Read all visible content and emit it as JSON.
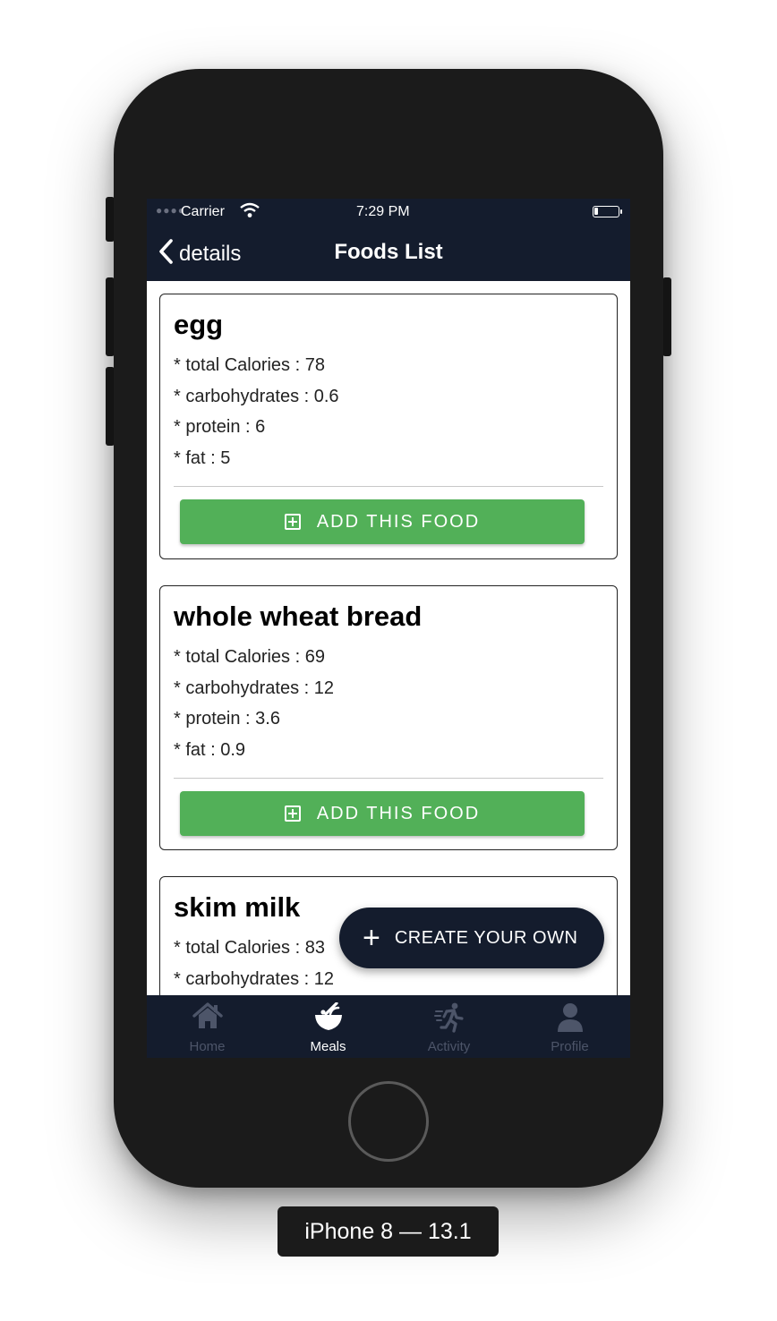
{
  "status_bar": {
    "carrier": "Carrier",
    "time": "7:29 PM"
  },
  "nav": {
    "back_label": "details",
    "title": "Foods List"
  },
  "foods": [
    {
      "name": "egg",
      "calories": "* total Calories : 78",
      "carbs": "* carbohydrates : 0.6",
      "protein": "* protein : 6",
      "fat": "* fat : 5"
    },
    {
      "name": "whole wheat bread",
      "calories": "* total Calories : 69",
      "carbs": "* carbohydrates : 12",
      "protein": "* protein : 3.6",
      "fat": "* fat : 0.9"
    },
    {
      "name": "skim milk",
      "calories": "* total Calories : 83",
      "carbs": "* carbohydrates : 12"
    }
  ],
  "add_button_label": "ADD THIS FOOD",
  "fab": {
    "label": "CREATE YOUR OWN"
  },
  "tabs": [
    {
      "label": "Home",
      "icon": "home-icon",
      "active": false
    },
    {
      "label": "Meals",
      "icon": "bowl-icon",
      "active": true
    },
    {
      "label": "Activity",
      "icon": "running-icon",
      "active": false
    },
    {
      "label": "Profile",
      "icon": "user-icon",
      "active": false
    }
  ],
  "device_label": "iPhone 8 — 13.1",
  "colors": {
    "nav_bg": "#141c2d",
    "accent_green": "#52b058",
    "inactive_tab": "#4d5569"
  }
}
